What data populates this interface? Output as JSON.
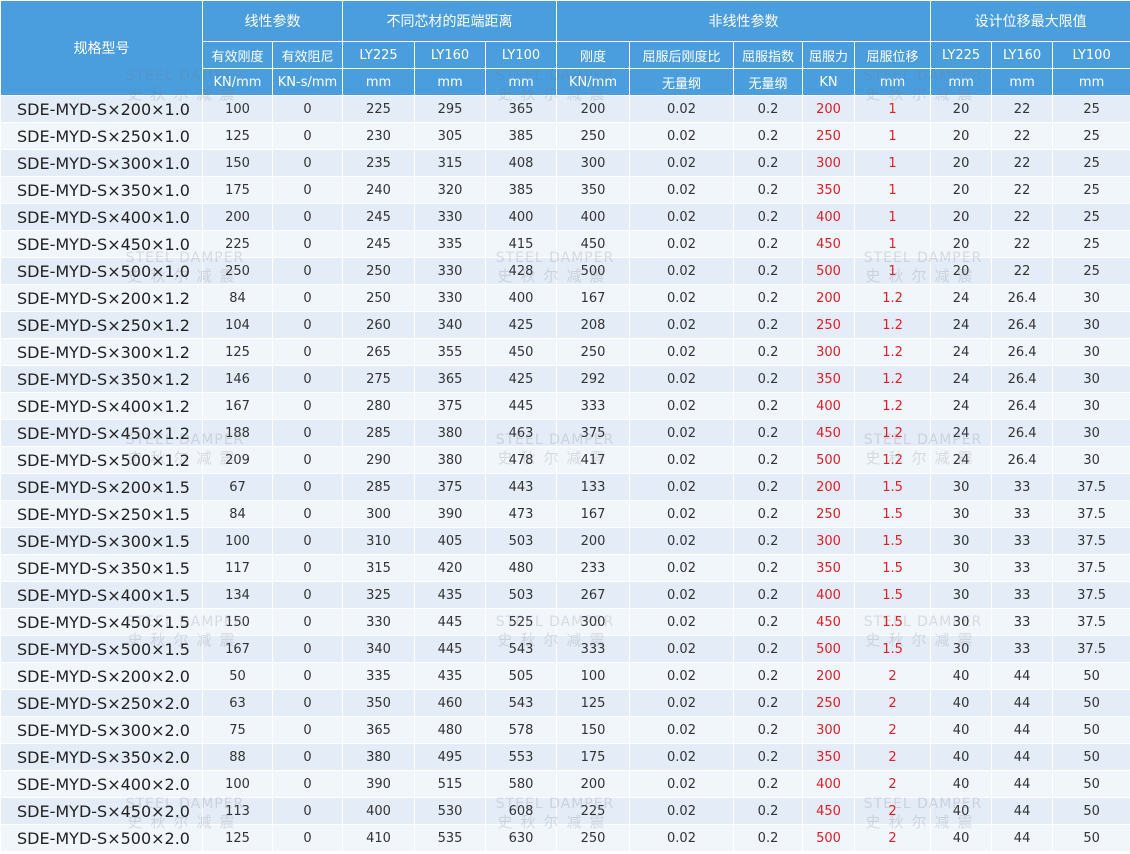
{
  "table": {
    "header_groups": [
      {
        "label": "规格型号"
      },
      {
        "label": "线性参数"
      },
      {
        "label": "不同芯材的距端距离"
      },
      {
        "label": "非线性参数"
      },
      {
        "label": "设计位移最大限值"
      }
    ],
    "subheaders": [
      "有效刚度",
      "有效阻尼",
      "LY225",
      "LY160",
      "LY100",
      "刚度",
      "屈服后刚度比",
      "屈服指数",
      "屈服力",
      "屈服位移",
      "LY225",
      "LY160",
      "LY100"
    ],
    "units": [
      "KN/mm",
      "KN-s/mm",
      "mm",
      "mm",
      "mm",
      "KN/mm",
      "无量纲",
      "无量纲",
      "KN",
      "mm",
      "mm",
      "mm",
      "mm"
    ],
    "rows": [
      [
        "SDE-MYD-S×200×1.0",
        "100",
        "0",
        "225",
        "295",
        "365",
        "200",
        "0.02",
        "0.2",
        "200",
        "1",
        "20",
        "22",
        "25"
      ],
      [
        "SDE-MYD-S×250×1.0",
        "125",
        "0",
        "230",
        "305",
        "385",
        "250",
        "0.02",
        "0.2",
        "250",
        "1",
        "20",
        "22",
        "25"
      ],
      [
        "SDE-MYD-S×300×1.0",
        "150",
        "0",
        "235",
        "315",
        "408",
        "300",
        "0.02",
        "0.2",
        "300",
        "1",
        "20",
        "22",
        "25"
      ],
      [
        "SDE-MYD-S×350×1.0",
        "175",
        "0",
        "240",
        "320",
        "385",
        "350",
        "0.02",
        "0.2",
        "350",
        "1",
        "20",
        "22",
        "25"
      ],
      [
        "SDE-MYD-S×400×1.0",
        "200",
        "0",
        "245",
        "330",
        "400",
        "400",
        "0.02",
        "0.2",
        "400",
        "1",
        "20",
        "22",
        "25"
      ],
      [
        "SDE-MYD-S×450×1.0",
        "225",
        "0",
        "245",
        "335",
        "415",
        "450",
        "0.02",
        "0.2",
        "450",
        "1",
        "20",
        "22",
        "25"
      ],
      [
        "SDE-MYD-S×500×1.0",
        "250",
        "0",
        "250",
        "330",
        "428",
        "500",
        "0.02",
        "0.2",
        "500",
        "1",
        "20",
        "22",
        "25"
      ],
      [
        "SDE-MYD-S×200×1.2",
        "84",
        "0",
        "250",
        "330",
        "400",
        "167",
        "0.02",
        "0.2",
        "200",
        "1.2",
        "24",
        "26.4",
        "30"
      ],
      [
        "SDE-MYD-S×250×1.2",
        "104",
        "0",
        "260",
        "340",
        "425",
        "208",
        "0.02",
        "0.2",
        "250",
        "1.2",
        "24",
        "26.4",
        "30"
      ],
      [
        "SDE-MYD-S×300×1.2",
        "125",
        "0",
        "265",
        "355",
        "450",
        "250",
        "0.02",
        "0.2",
        "300",
        "1.2",
        "24",
        "26.4",
        "30"
      ],
      [
        "SDE-MYD-S×350×1.2",
        "146",
        "0",
        "275",
        "365",
        "425",
        "292",
        "0.02",
        "0.2",
        "350",
        "1.2",
        "24",
        "26.4",
        "30"
      ],
      [
        "SDE-MYD-S×400×1.2",
        "167",
        "0",
        "280",
        "375",
        "445",
        "333",
        "0.02",
        "0.2",
        "400",
        "1.2",
        "24",
        "26.4",
        "30"
      ],
      [
        "SDE-MYD-S×450×1.2",
        "188",
        "0",
        "285",
        "380",
        "463",
        "375",
        "0.02",
        "0.2",
        "450",
        "1.2",
        "24",
        "26.4",
        "30"
      ],
      [
        "SDE-MYD-S×500×1.2",
        "209",
        "0",
        "290",
        "380",
        "478",
        "417",
        "0.02",
        "0.2",
        "500",
        "1.2",
        "24",
        "26.4",
        "30"
      ],
      [
        "SDE-MYD-S×200×1.5",
        "67",
        "0",
        "285",
        "375",
        "443",
        "133",
        "0.02",
        "0.2",
        "200",
        "1.5",
        "30",
        "33",
        "37.5"
      ],
      [
        "SDE-MYD-S×250×1.5",
        "84",
        "0",
        "300",
        "390",
        "473",
        "167",
        "0.02",
        "0.2",
        "250",
        "1.5",
        "30",
        "33",
        "37.5"
      ],
      [
        "SDE-MYD-S×300×1.5",
        "100",
        "0",
        "310",
        "405",
        "503",
        "200",
        "0.02",
        "0.2",
        "300",
        "1.5",
        "30",
        "33",
        "37.5"
      ],
      [
        "SDE-MYD-S×350×1.5",
        "117",
        "0",
        "315",
        "420",
        "480",
        "233",
        "0.02",
        "0.2",
        "350",
        "1.5",
        "30",
        "33",
        "37.5"
      ],
      [
        "SDE-MYD-S×400×1.5",
        "134",
        "0",
        "325",
        "435",
        "503",
        "267",
        "0.02",
        "0.2",
        "400",
        "1.5",
        "30",
        "33",
        "37.5"
      ],
      [
        "SDE-MYD-S×450×1.5",
        "150",
        "0",
        "330",
        "445",
        "525",
        "300",
        "0.02",
        "0.2",
        "450",
        "1.5",
        "30",
        "33",
        "37.5"
      ],
      [
        "SDE-MYD-S×500×1.5",
        "167",
        "0",
        "340",
        "445",
        "543",
        "333",
        "0.02",
        "0.2",
        "500",
        "1.5",
        "30",
        "33",
        "37.5"
      ],
      [
        "SDE-MYD-S×200×2.0",
        "50",
        "0",
        "335",
        "435",
        "505",
        "100",
        "0.02",
        "0.2",
        "200",
        "2",
        "40",
        "44",
        "50"
      ],
      [
        "SDE-MYD-S×250×2.0",
        "63",
        "0",
        "350",
        "460",
        "543",
        "125",
        "0.02",
        "0.2",
        "250",
        "2",
        "40",
        "44",
        "50"
      ],
      [
        "SDE-MYD-S×300×2.0",
        "75",
        "0",
        "365",
        "480",
        "578",
        "150",
        "0.02",
        "0.2",
        "300",
        "2",
        "40",
        "44",
        "50"
      ],
      [
        "SDE-MYD-S×350×2.0",
        "88",
        "0",
        "380",
        "495",
        "553",
        "175",
        "0.02",
        "0.2",
        "350",
        "2",
        "40",
        "44",
        "50"
      ],
      [
        "SDE-MYD-S×400×2.0",
        "100",
        "0",
        "390",
        "515",
        "580",
        "200",
        "0.02",
        "0.2",
        "400",
        "2",
        "40",
        "44",
        "50"
      ],
      [
        "SDE-MYD-S×450×2.0",
        "113",
        "0",
        "400",
        "530",
        "608",
        "225",
        "0.02",
        "0.2",
        "450",
        "2",
        "40",
        "44",
        "50"
      ],
      [
        "SDE-MYD-S×500×2.0",
        "125",
        "0",
        "410",
        "535",
        "630",
        "250",
        "0.02",
        "0.2",
        "500",
        "2",
        "40",
        "44",
        "50"
      ]
    ]
  },
  "watermark": {
    "en": "STEEL DAMPER",
    "cn": "史秋尔减震"
  },
  "colors": {
    "header_bg": "#4a9ede",
    "row_a": "#e3ecf7",
    "row_b": "#f1f6fb",
    "highlight": "#e31e24"
  }
}
